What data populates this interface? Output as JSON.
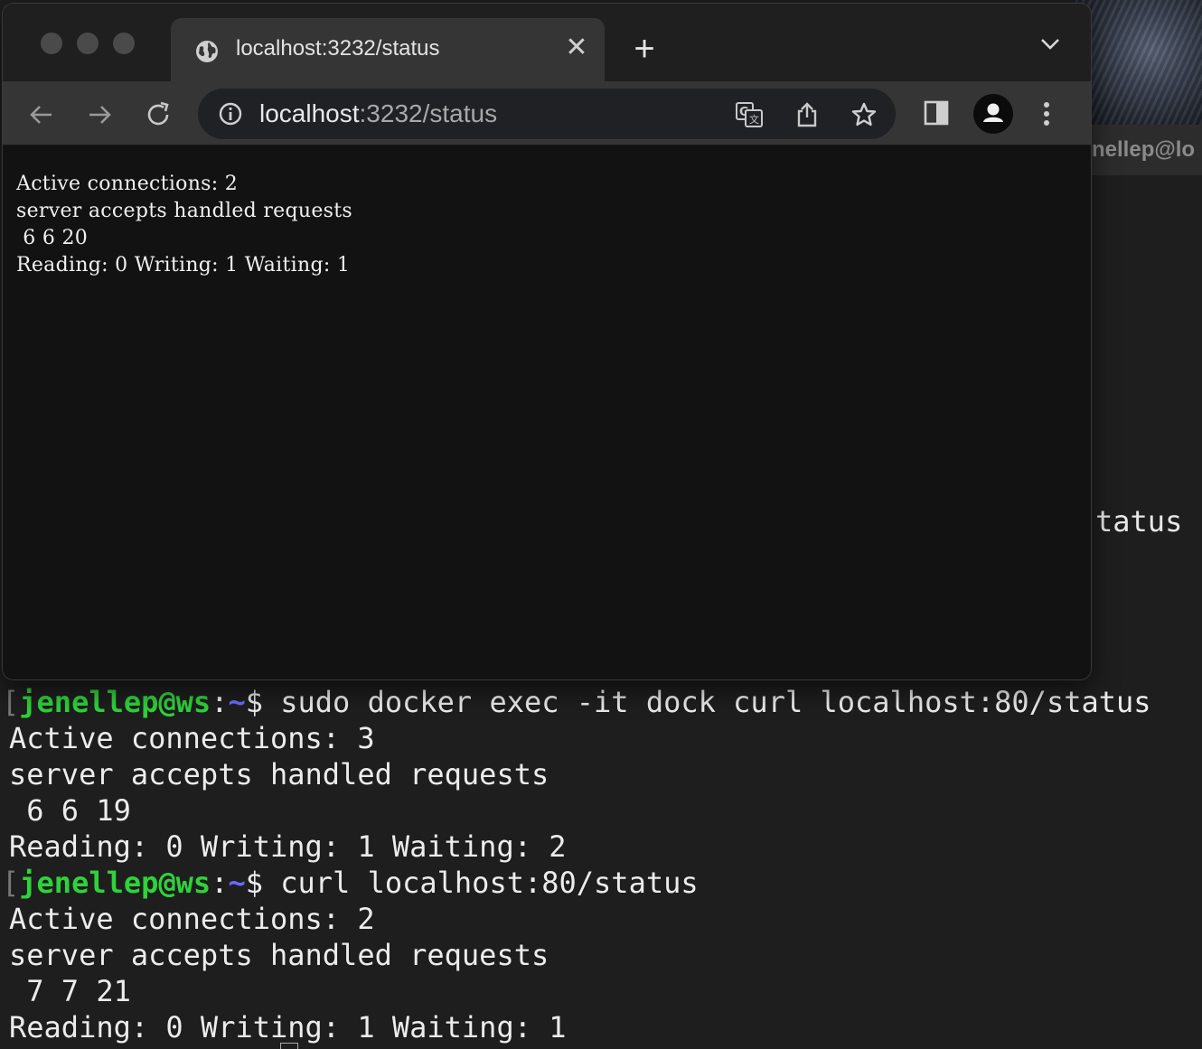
{
  "browser": {
    "tab_title": "localhost:3232/status",
    "tab_close": "✕",
    "new_tab": "+",
    "url_host": "localhost",
    "url_rest": ":3232/status",
    "page_lines": [
      "Active connections: 2",
      "server accepts handled requests",
      " 6 6 20",
      "Reading: 0 Writing: 1 Waiting: 1"
    ],
    "icons": [
      "globe-icon",
      "close-icon",
      "plus-icon",
      "chevron-down-icon",
      "back-arrow-icon",
      "forward-arrow-icon",
      "reload-icon",
      "info-icon",
      "translate-icon",
      "share-icon",
      "star-icon",
      "side-panel-icon",
      "profile-icon",
      "kebab-menu-icon"
    ]
  },
  "terminal": {
    "title_fragment": "nellep@lo",
    "peek_text": "tatus",
    "prompt_user": "jenellep@ws",
    "prompt_colon": ":",
    "prompt_path": "~",
    "prompt_dollar": "$",
    "commands": [
      {
        "command": " sudo docker exec -it dock curl localhost:80/status",
        "output": [
          "Active connections: 3",
          "server accepts handled requests",
          " 6 6 19",
          "Reading: 0 Writing: 1 Waiting: 2"
        ]
      },
      {
        "command": " curl localhost:80/status",
        "output": [
          "Active connections: 2",
          "server accepts handled requests",
          " 7 7 21",
          "Reading: 0 Writing: 1 Waiting: 1"
        ]
      }
    ]
  },
  "colors": {
    "prompt_user": "#2fd23a",
    "prompt_path": "#6a6bff",
    "terminal_bg": "#1e1e1e",
    "browser_page_bg": "#121212"
  }
}
